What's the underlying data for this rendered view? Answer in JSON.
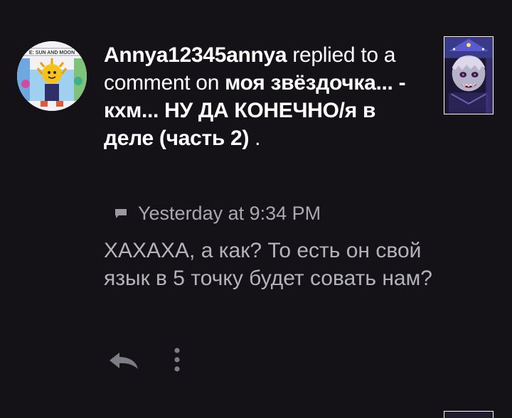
{
  "notification": {
    "username": "Annya12345annya",
    "action_text": " replied to a comment on ",
    "post_title": "моя звёздочка... - кхм... НУ ДА КОНЕЧНО/я в деле (часть 2)",
    "post_title_suffix": " .",
    "timestamp": "Yesterday at 9:34 PM",
    "comment_text": "ХАХАХА, а как? То есть он свой язык в 5 точку будет совать нам?",
    "avatar_caption": "E: SUN AND MOON"
  },
  "icons": {
    "avatar": "sun-and-moon-avatar",
    "thumbnail": "post-thumbnail",
    "comment": "comment-icon",
    "reply": "reply-icon",
    "more": "more-vertical-icon"
  },
  "colors": {
    "background": "#141216",
    "primary_text": "#ffffff",
    "secondary_text": "#a9a9b0",
    "comment_text": "#b3b3ba"
  }
}
